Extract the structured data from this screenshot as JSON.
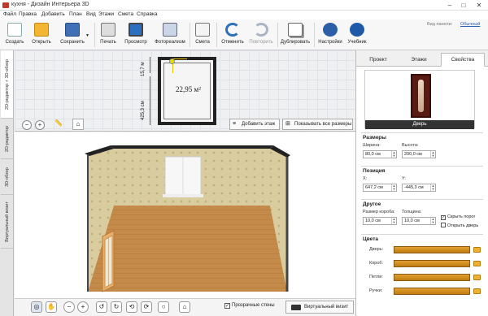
{
  "window": {
    "title": "кухня - Дизайн Интерьера 3D",
    "minimize": "–",
    "maximize": "□",
    "close": "✕"
  },
  "menu": [
    "Файл",
    "Правка",
    "Добавить",
    "План",
    "Вид",
    "Этажи",
    "Смета",
    "Справка"
  ],
  "toolbar": {
    "buttons": [
      {
        "label": "Создать",
        "icon": "new-document-icon"
      },
      {
        "label": "Открыть",
        "icon": "open-folder-icon"
      },
      {
        "label": "Сохранить",
        "icon": "save-disk-icon"
      },
      {
        "label": "Печать",
        "icon": "printer-icon"
      },
      {
        "label": "Просмотр",
        "icon": "monitor-icon"
      },
      {
        "label": "Фотореализм",
        "icon": "photo-icon"
      },
      {
        "label": "Смета",
        "icon": "estimate-icon"
      },
      {
        "label": "Отменить",
        "icon": "undo-icon"
      },
      {
        "label": "Повторить",
        "icon": "redo-icon"
      },
      {
        "label": "Дублировать",
        "icon": "duplicate-icon"
      },
      {
        "label": "Настройки",
        "icon": "gear-icon"
      },
      {
        "label": "Учебник",
        "icon": "tutorial-icon"
      }
    ],
    "view_type_label": "Вид панели:",
    "view_type_value": "Обычный"
  },
  "left_tabs": [
    "2D-редактор + 3D-обзор",
    "2D-редактор",
    "3D-обзор",
    "Виртуальный визит"
  ],
  "plan2d": {
    "area_label": "22,95 м²",
    "dim_top": "15,7 м",
    "dim_left": "425,3 см",
    "add_floor_label": "Добавить этаж",
    "show_all_dims_label": "Показывать все размеры"
  },
  "bottom_bar": {
    "transparent_walls_label": "Прозрачные стены",
    "virtual_visit_label": "Виртуальный визит"
  },
  "right_panel": {
    "tabs": [
      "Проект",
      "Этажи",
      "Свойства"
    ],
    "active_tab": "Свойства",
    "preview_caption": "Дверь",
    "sizes": {
      "title": "Размеры",
      "width_label": "Ширина:",
      "width_value": "80,0 см",
      "height_label": "Высота:",
      "height_value": "200,0 см"
    },
    "position": {
      "title": "Позиция",
      "x_label": "X:",
      "x_value": "647,2 см",
      "y_label": "Y:",
      "y_value": "-445,3 см"
    },
    "other": {
      "title": "Другое",
      "frame_label": "Размер короба:",
      "frame_value": "10,0 см",
      "thickness_label": "Толщина:",
      "thickness_value": "10,0 см",
      "hide_threshold_label": "Скрыть порог",
      "hide_threshold_checked": true,
      "open_door_label": "Открыть дверь",
      "open_door_checked": false
    },
    "colors": {
      "title": "Цвета",
      "rows": [
        {
          "label": "Дверь:"
        },
        {
          "label": "Короб:"
        },
        {
          "label": "Петли:"
        },
        {
          "label": "Ручки:"
        }
      ],
      "wood_color": "#d08c20"
    }
  }
}
